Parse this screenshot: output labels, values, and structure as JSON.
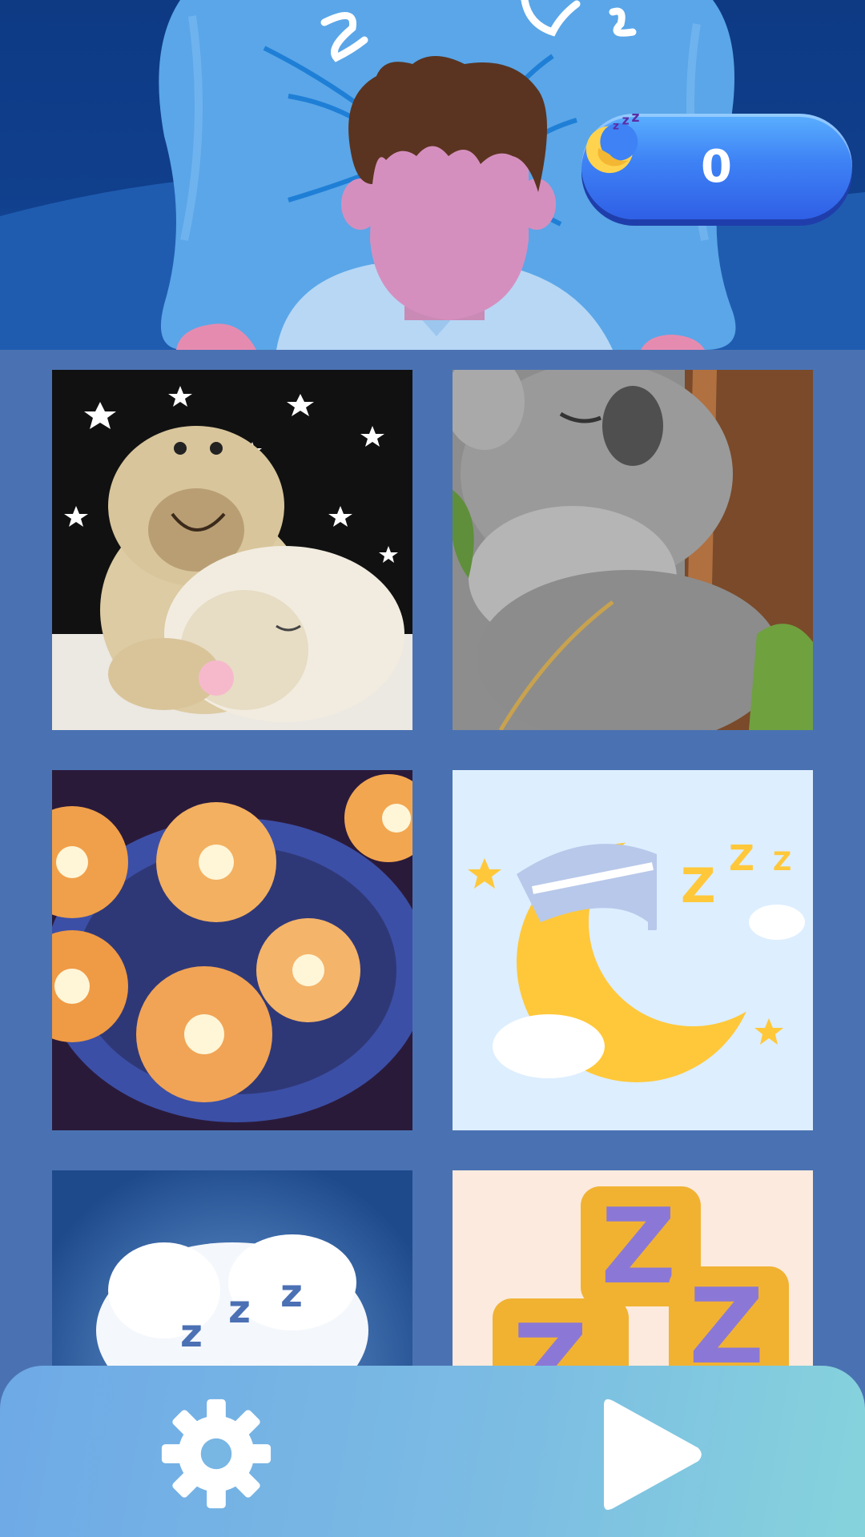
{
  "score": {
    "value": "0",
    "icon": "sleeping-moon-icon"
  },
  "header": {
    "illustration": "sleeping-boy-on-pillow"
  },
  "tiles": [
    {
      "name": "tile-sheep-plush"
    },
    {
      "name": "tile-koala"
    },
    {
      "name": "tile-lotus-candles"
    },
    {
      "name": "tile-moon-zzz"
    },
    {
      "name": "tile-cloud-zzz"
    },
    {
      "name": "tile-zzz-letters"
    }
  ],
  "bottom_bar": {
    "settings_icon": "gear-icon",
    "play_icon": "play-icon"
  },
  "colors": {
    "background": "#4a72b2",
    "header_dark": "#0e3a84",
    "pill": "#3e82f5",
    "bottom_bar_start": "#6ea9e6",
    "bottom_bar_end": "#86d3dc"
  }
}
